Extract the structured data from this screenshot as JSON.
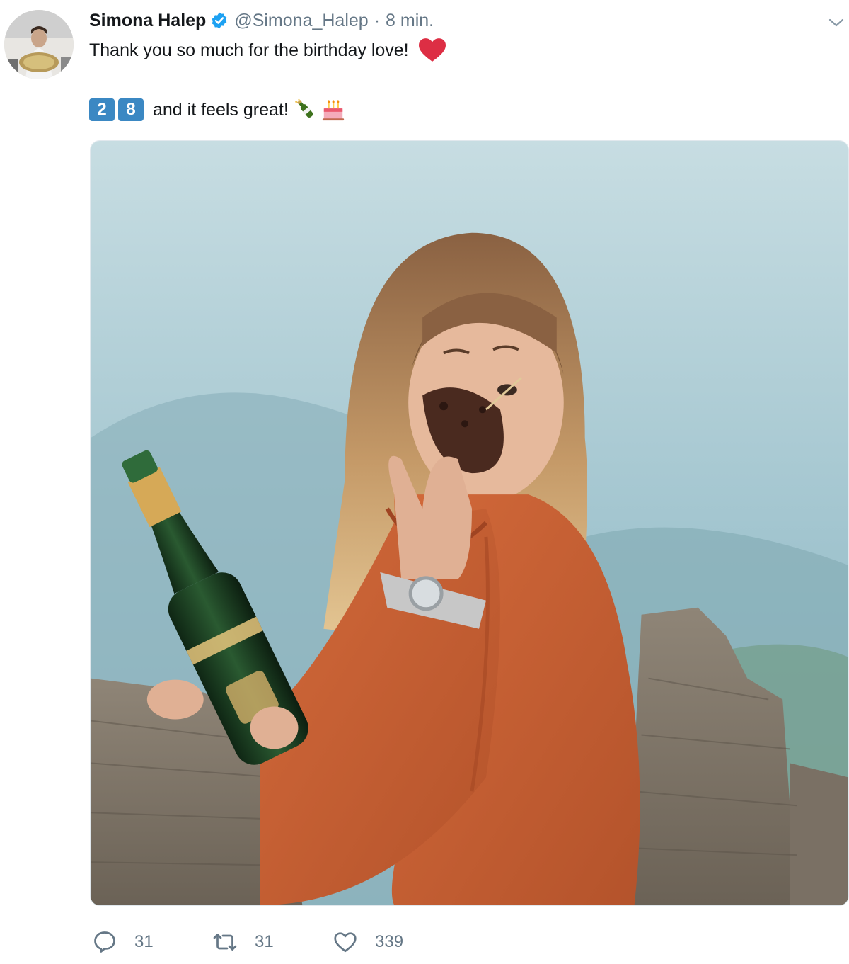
{
  "tweet": {
    "author": {
      "display_name": "Simona Halep",
      "handle": "@Simona_Halep",
      "verified": true
    },
    "separator": "·",
    "timestamp": "8 min.",
    "text_line1": "Thank you so much for the birthday love!",
    "text_line1_emoji": "red-heart",
    "keycaps": [
      "2",
      "8"
    ],
    "text_line2": "and it feels great!",
    "text_line2_emojis": [
      "champagne-bottle",
      "birthday-cake"
    ],
    "media": {
      "type": "photo"
    },
    "actions": {
      "replies": "31",
      "retweets": "31",
      "likes": "339"
    }
  },
  "colors": {
    "verified_blue": "#1da1f2",
    "secondary_text": "#657786",
    "heart_red": "#dd2e44",
    "keycap_blue": "#3b88c3"
  }
}
